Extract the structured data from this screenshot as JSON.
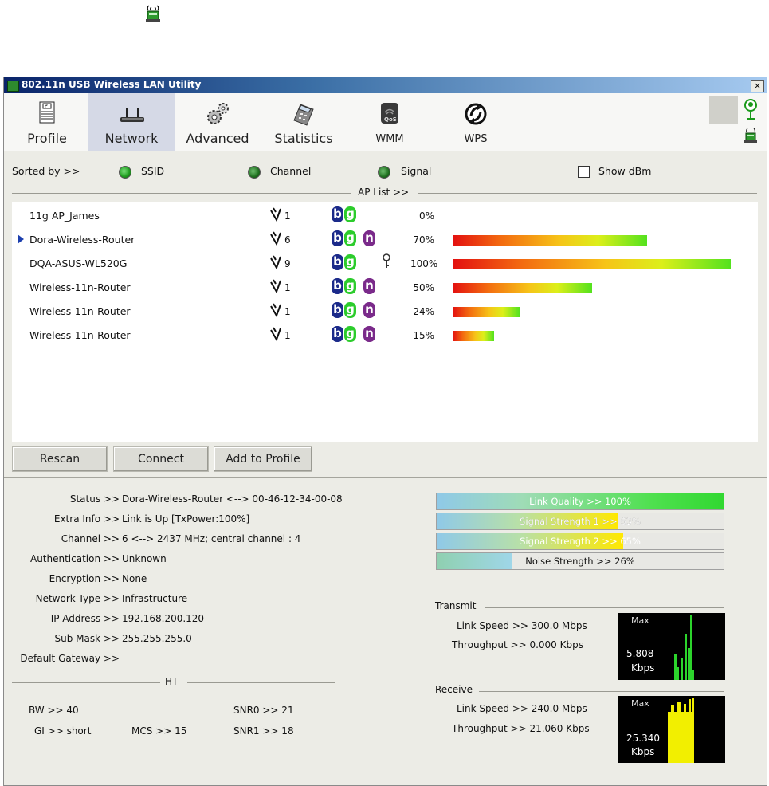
{
  "window": {
    "title": "802.11n USB Wireless LAN Utility",
    "close": "×"
  },
  "toolbar": {
    "items": [
      {
        "label": "Profile"
      },
      {
        "label": "Network"
      },
      {
        "label": "Advanced"
      },
      {
        "label": "Statistics"
      },
      {
        "label": "WMM"
      },
      {
        "label": "WPS"
      }
    ]
  },
  "sort": {
    "label": "Sorted by >>",
    "ssid": "SSID",
    "channel": "Channel",
    "signal": "Signal",
    "show_dbm": "Show dBm",
    "ap_list_title": "AP List >>"
  },
  "ap_list": [
    {
      "ssid": "11g AP_James",
      "channel": "1",
      "modes": "bg",
      "secured": false,
      "signal_text": "0%",
      "signal": 0,
      "selected": false
    },
    {
      "ssid": "Dora-Wireless-Router",
      "channel": "6",
      "modes": "bgn",
      "secured": false,
      "signal_text": "70%",
      "signal": 70,
      "selected": true
    },
    {
      "ssid": "DQA-ASUS-WL520G",
      "channel": "9",
      "modes": "bg",
      "secured": true,
      "signal_text": "100%",
      "signal": 100,
      "selected": false
    },
    {
      "ssid": "Wireless-11n-Router",
      "channel": "1",
      "modes": "bgn",
      "secured": false,
      "signal_text": "50%",
      "signal": 50,
      "selected": false
    },
    {
      "ssid": "Wireless-11n-Router",
      "channel": "1",
      "modes": "bgn",
      "secured": false,
      "signal_text": "24%",
      "signal": 24,
      "selected": false
    },
    {
      "ssid": "Wireless-11n-Router",
      "channel": "1",
      "modes": "bgn",
      "secured": false,
      "signal_text": "15%",
      "signal": 15,
      "selected": false
    }
  ],
  "buttons": {
    "rescan": "Rescan",
    "connect": "Connect",
    "add_to_profile": "Add to Profile"
  },
  "status": {
    "rows": [
      {
        "key": "Status >>",
        "value": "Dora-Wireless-Router <--> 00-46-12-34-00-08"
      },
      {
        "key": "Extra Info >>",
        "value": "Link is Up [TxPower:100%]"
      },
      {
        "key": "Channel >>",
        "value": "6 <--> 2437 MHz; central channel : 4"
      },
      {
        "key": "Authentication >>",
        "value": "Unknown"
      },
      {
        "key": "Encryption >>",
        "value": "None"
      },
      {
        "key": "Network Type >>",
        "value": "Infrastructure"
      },
      {
        "key": "IP Address >>",
        "value": "192.168.200.120"
      },
      {
        "key": "Sub Mask >>",
        "value": "255.255.255.0"
      },
      {
        "key": "Default Gateway >>",
        "value": ""
      }
    ],
    "ht_title": "HT",
    "bw": "BW >> 40",
    "gi": "GI >> short",
    "mcs": "MCS >> 15",
    "snr0": "SNR0 >> 21",
    "snr1": "SNR1 >> 18"
  },
  "meters": {
    "link_quality": {
      "text": "Link Quality >> 100%",
      "value": 100
    },
    "signal_1": {
      "text": "Signal Strength 1 >> 63%",
      "value": 63
    },
    "signal_2": {
      "text": "Signal Strength 2 >> 65%",
      "value": 65
    },
    "noise": {
      "text": "Noise Strength >> 26%",
      "value": 26
    }
  },
  "transmit": {
    "title": "Transmit",
    "link_speed": "Link Speed >> 300.0 Mbps",
    "throughput": "Throughput >> 0.000 Kbps",
    "graph_max": "Max",
    "graph_value": "5.808",
    "graph_unit": "Kbps"
  },
  "receive": {
    "title": "Receive",
    "link_speed": "Link Speed >> 240.0 Mbps",
    "throughput": "Throughput >> 21.060 Kbps",
    "graph_max": "Max",
    "graph_value": "25.340",
    "graph_unit": "Kbps"
  },
  "colors": {
    "selection_arrow": "#1c3fae",
    "mode_b": "#1b2a8a",
    "mode_g": "#2ccc2c",
    "mode_n": "#7a2a8a",
    "tx_graph": "#2cd42c",
    "rx_graph": "#f2ef00"
  }
}
